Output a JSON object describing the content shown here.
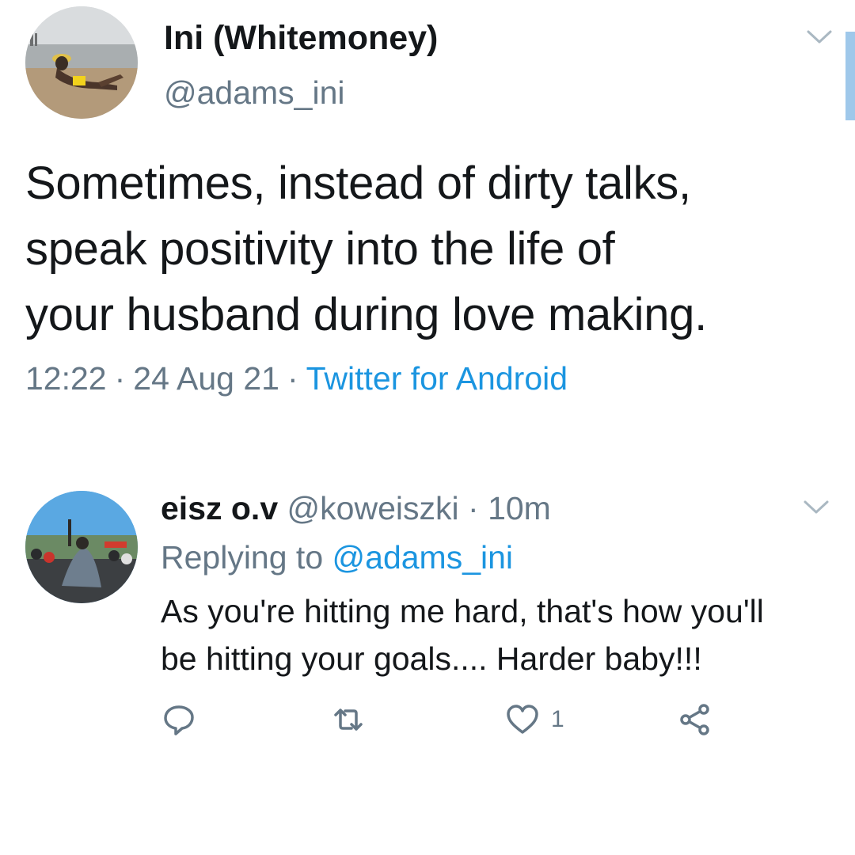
{
  "main_tweet": {
    "display_name": "Ini (Whitemoney)",
    "handle": "@adams_ini",
    "text": "Sometimes, instead of dirty talks,\nspeak positivity into the life of\nyour husband during love making.",
    "time": "12:22",
    "separator": "·",
    "date": "24 Aug 21",
    "source": "Twitter for Android",
    "avatar_icon": "profile-photo-beach",
    "menu_icon": "chevron-down-icon"
  },
  "reply": {
    "display_name": "eisz o.v",
    "handle": "@koweiszki",
    "separator": "·",
    "age": "10m",
    "replying_prefix": "Replying to",
    "replying_to": "@adams_ini",
    "text": "As you're hitting me hard, that's how you'll\nbe hitting your goals.... Harder baby!!!",
    "avatar_icon": "profile-photo-protest",
    "menu_icon": "chevron-down-icon",
    "actions": {
      "reply_icon": "reply-bubble-icon",
      "retweet_icon": "retweet-icon",
      "like_icon": "heart-icon",
      "like_count": "1",
      "share_icon": "share-icon"
    }
  },
  "colors": {
    "text_primary": "#14171a",
    "text_secondary": "#657786",
    "link": "#1b95e0",
    "background": "#ffffff"
  }
}
